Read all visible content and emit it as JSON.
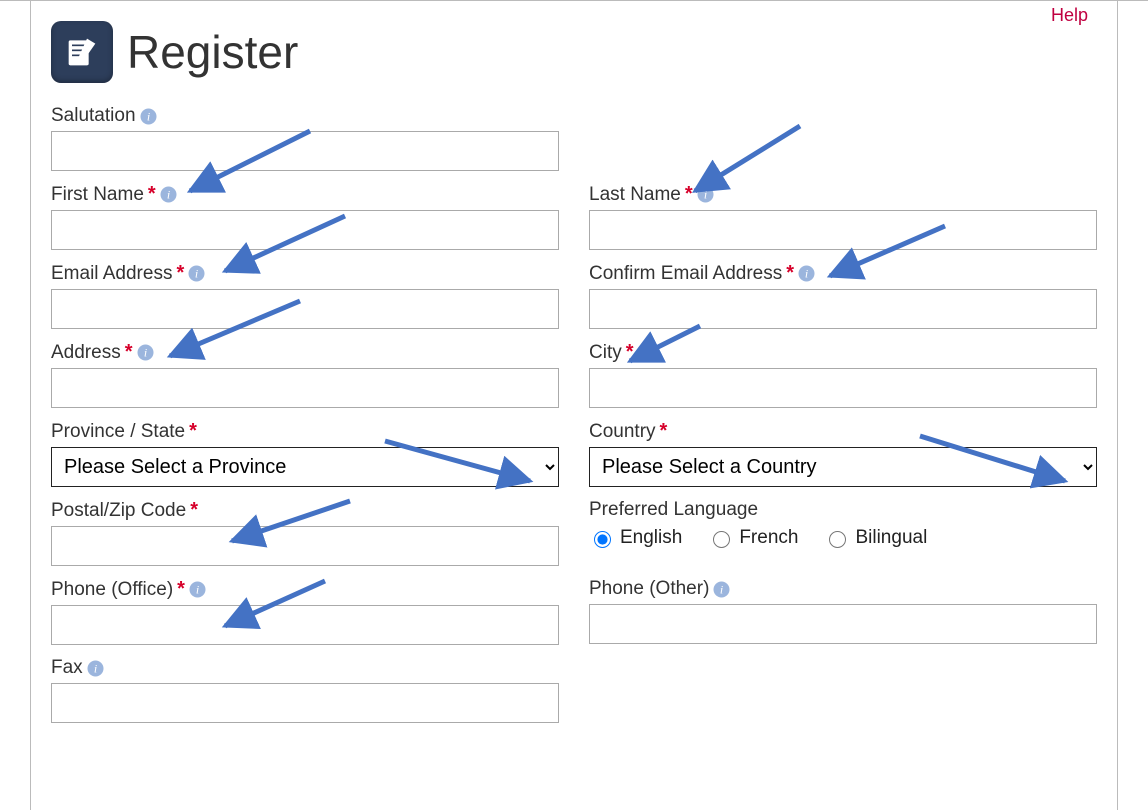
{
  "page": {
    "title": "Register",
    "help": "Help"
  },
  "fields": {
    "salutation": {
      "label": "Salutation",
      "value": "",
      "required": false,
      "info": true
    },
    "first_name": {
      "label": "First Name",
      "value": "",
      "required": true,
      "info": true
    },
    "last_name": {
      "label": "Last Name",
      "value": "",
      "required": true,
      "info": true
    },
    "email": {
      "label": "Email Address",
      "value": "",
      "required": true,
      "info": true
    },
    "confirm_email": {
      "label": "Confirm Email Address",
      "value": "",
      "required": true,
      "info": true
    },
    "address": {
      "label": "Address",
      "value": "",
      "required": true,
      "info": true
    },
    "city": {
      "label": "City",
      "value": "",
      "required": true,
      "info": true
    },
    "province": {
      "label": "Province / State",
      "required": true,
      "info": false,
      "placeholder": "Please Select a Province"
    },
    "country": {
      "label": "Country",
      "required": true,
      "info": false,
      "placeholder": "Please Select a Country"
    },
    "postal": {
      "label": "Postal/Zip Code",
      "value": "",
      "required": true,
      "info": false
    },
    "preferred_language": {
      "label": "Preferred Language",
      "options": [
        "English",
        "French",
        "Bilingual"
      ],
      "selected": "English"
    },
    "phone_office": {
      "label": "Phone (Office)",
      "value": "",
      "required": true,
      "info": true
    },
    "phone_other": {
      "label": "Phone (Other)",
      "value": "",
      "required": false,
      "info": true
    },
    "fax": {
      "label": "Fax",
      "value": "",
      "required": false,
      "info": true
    }
  },
  "asterisk": "*"
}
